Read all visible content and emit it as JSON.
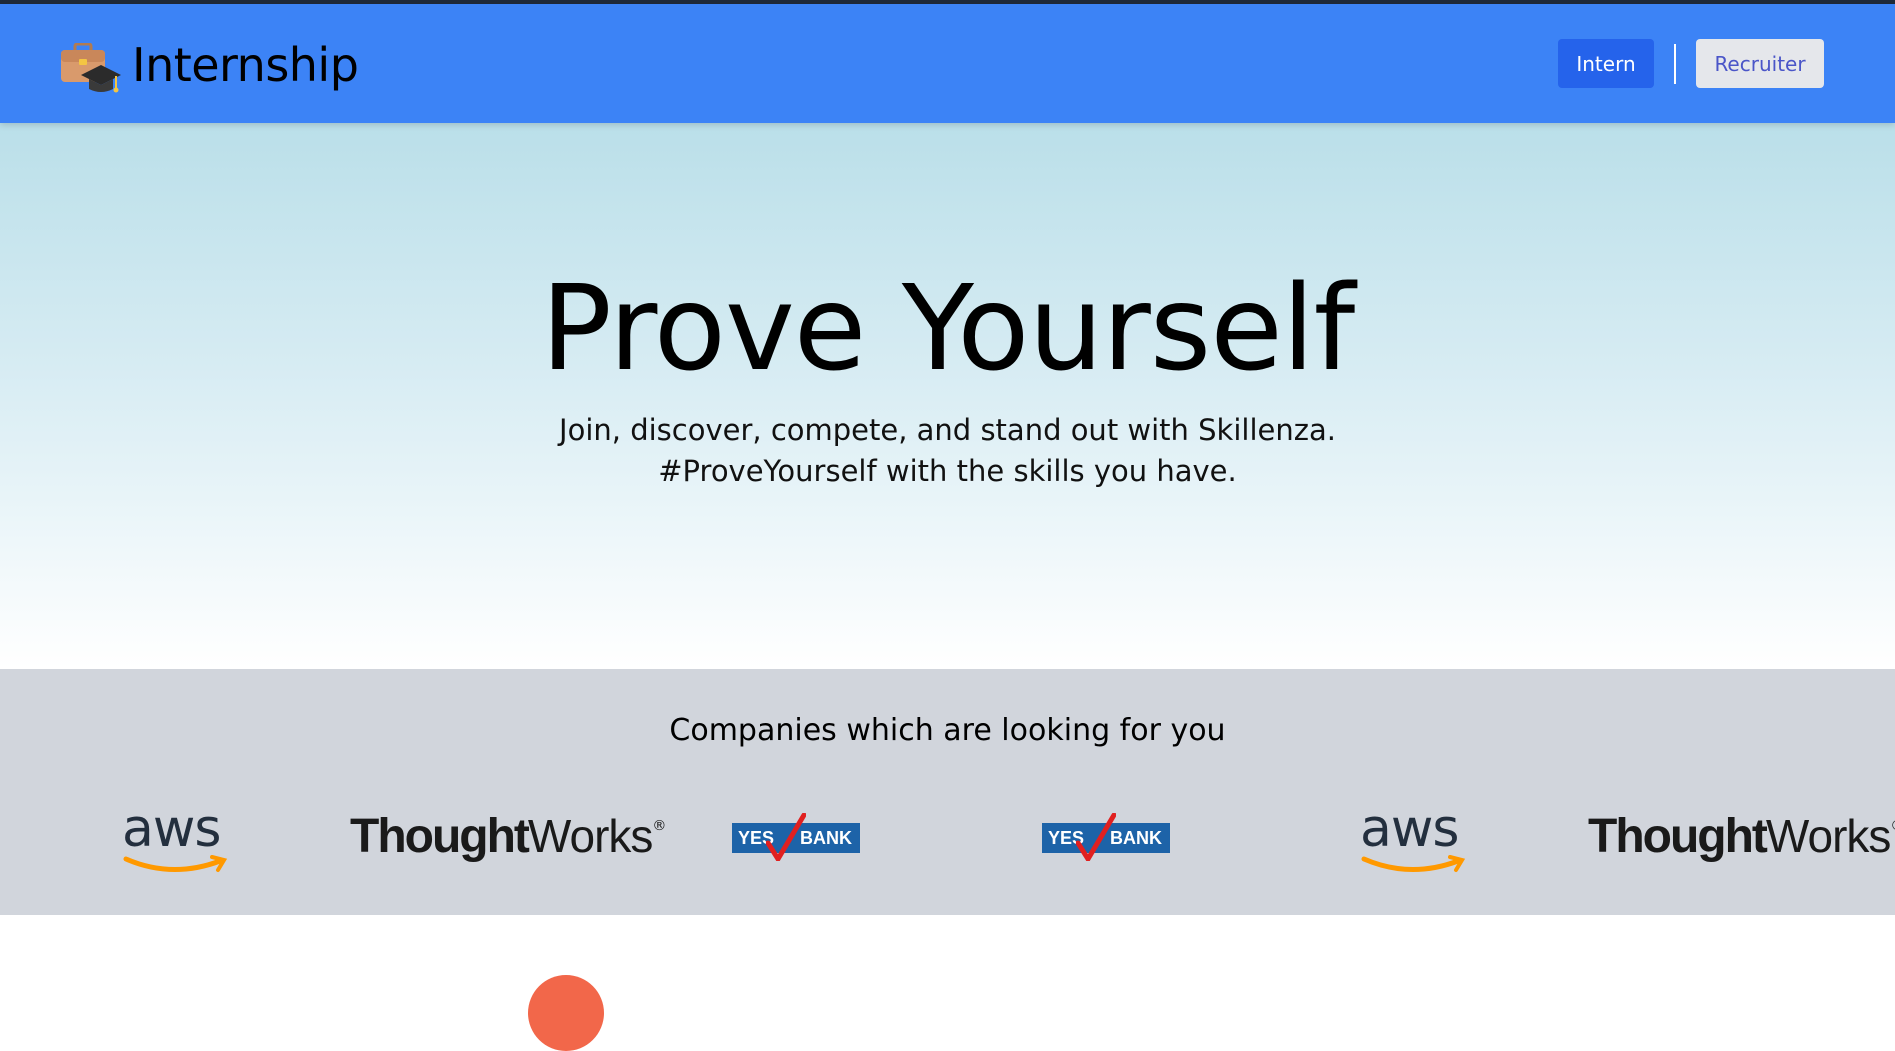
{
  "header": {
    "title": "Internship",
    "intern_label": "Intern",
    "recruiter_label": "Recruiter",
    "accent_color": "#3c83f6"
  },
  "hero": {
    "heading": "Prove Yourself",
    "subtitle_line1": "Join, discover, compete, and stand out with Skillenza.",
    "subtitle_line2": "#ProveYourself with the skills you have."
  },
  "companies": {
    "heading": "Companies which are looking for you",
    "logos": [
      {
        "name": "aws",
        "text": "aws"
      },
      {
        "name": "thoughtworks",
        "text_bold": "Thought",
        "text_rest": "Works"
      },
      {
        "name": "yes-bank",
        "text_left": "YES",
        "text_right": "BANK"
      },
      {
        "name": "yes-bank",
        "text_left": "YES",
        "text_right": "BANK"
      },
      {
        "name": "aws",
        "text": "aws"
      },
      {
        "name": "thoughtworks",
        "text_bold": "Thought",
        "text_rest": "Works"
      }
    ]
  },
  "icons": {
    "brand": "briefcase-graduation-cap-icon"
  }
}
